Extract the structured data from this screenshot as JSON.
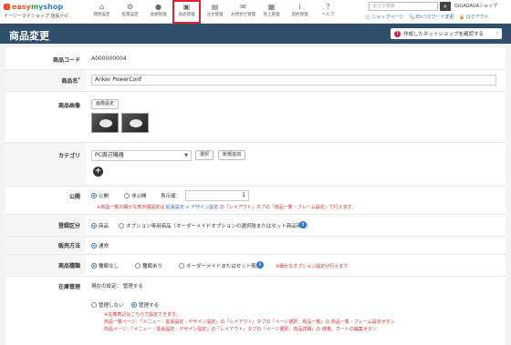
{
  "brand": {
    "logo_text": "easy my shop",
    "logo_e": "easy",
    "logo_m": "my",
    "logo_s": "shop",
    "sub": "イージーマイショップ 店長ナビ"
  },
  "nav": [
    {
      "icon": "home-icon",
      "glyph": "⌂",
      "label": "開始設定"
    },
    {
      "icon": "gear-icon",
      "glyph": "⚙",
      "label": "拡張設定"
    },
    {
      "icon": "user-icon",
      "glyph": "●",
      "label": "会員管理"
    },
    {
      "icon": "gift-icon",
      "glyph": "▣",
      "label": "商品管理"
    },
    {
      "icon": "document-icon",
      "glyph": "▤",
      "label": "注文管理"
    },
    {
      "icon": "mail-icon",
      "glyph": "✉",
      "label": "お問合せ管理"
    },
    {
      "icon": "chart-icon",
      "glyph": "▦",
      "label": "売上管理"
    },
    {
      "icon": "info-icon",
      "glyph": "i",
      "label": "契約管理"
    },
    {
      "icon": "help-icon",
      "glyph": "?",
      "label": "ヘルプ"
    }
  ],
  "search": {
    "placeholder": "全注文検索"
  },
  "shop_name": "GIGAGAGAショップ",
  "top_links": {
    "shop_page": "ショップページ",
    "id_password": "ID/パスワード変更",
    "logout": "ログアウト"
  },
  "header": {
    "title": "商品変更",
    "confirm_button": "作成したネットショップを確認する"
  },
  "form": {
    "code": {
      "label": "商品コード",
      "value": "A000000004"
    },
    "name": {
      "label": "商品名",
      "required_mark": "*",
      "value": "Anker PowerConf"
    },
    "image": {
      "label": "商品画像",
      "button": "画像設定"
    },
    "category": {
      "label": "カテゴリ",
      "selected": "PC周辺機器",
      "select_button": "選択",
      "add_button": "新規追加"
    },
    "publish": {
      "label": "公開",
      "opt_public": "公開",
      "opt_private": "非公開",
      "order_label": "表示順：",
      "order_value": "1",
      "note_pre": "※商品一覧の細かな表示順設定は ",
      "note_link": "拡張設定 > デザイン設定",
      "note_post": " の「レイアウト」タブの「商品一覧・フレーム設定」で行えます。"
    },
    "registration": {
      "label": "登録区分",
      "opt_product": "商品",
      "opt_option": "オプション専用商品（オーダーメイドオプションの選択肢またはセット商品専用）"
    },
    "sales_method": {
      "label": "販売方法",
      "opt_normal": "通常"
    },
    "product_type": {
      "label": "商品種類",
      "opt_none": "種類なし",
      "opt_types": "種類あり",
      "opt_order": "オーダーメイドまたはセット販売",
      "note": "※細かなオプション設定が行えます"
    },
    "stock": {
      "label": "在庫管理",
      "current": "現在の設定： 管理する",
      "opt_off": "管理しない",
      "opt_on": "管理する",
      "note1": "※在庫表記はこちらで設定できます。",
      "note2_pre": "商品一覧ページ：「メニュー - 拡張設定 - デザイン設定」の「レイアウト」タブの「ページ選択：商品一覧」の 商品一覧・フレーム設定ボタン",
      "note3_pre": "商品ページ：「メニュー - 拡張設定 - デザイン設定」の「レイアウト」タブの「ページ選択：商品詳細」の 価格、カートの編集ボタン"
    }
  },
  "colors": {
    "header_bg": "#2f4f6a",
    "active_nav_border": "#e0202a",
    "link": "#2a6db5",
    "warning": "#d0302a"
  }
}
